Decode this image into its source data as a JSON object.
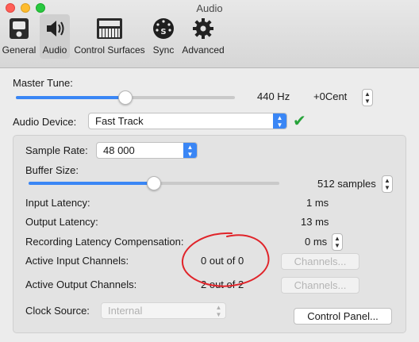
{
  "window": {
    "title": "Audio"
  },
  "toolbar": {
    "tabs": [
      {
        "label": "General",
        "icon": "speaker-box-icon"
      },
      {
        "label": "Audio",
        "icon": "speaker-icon"
      },
      {
        "label": "Control Surfaces",
        "icon": "keyboard-icon"
      },
      {
        "label": "Sync",
        "icon": "sync-icon"
      },
      {
        "label": "Advanced",
        "icon": "gear-icon"
      }
    ],
    "active": "Audio"
  },
  "master_tune": {
    "label": "Master Tune:",
    "hz": "440 Hz",
    "cent": "+0Cent",
    "level": 0.5
  },
  "audio_device": {
    "label": "Audio Device:",
    "value": "Fast Track",
    "status_color": "#27a33a"
  },
  "sample_rate": {
    "label": "Sample Rate:",
    "value": "48 000"
  },
  "buffer_size": {
    "label": "Buffer Size:",
    "value": "512 samples",
    "level": 0.5
  },
  "input_latency": {
    "label": "Input Latency:",
    "value": "1 ms"
  },
  "output_latency": {
    "label": "Output Latency:",
    "value": "13 ms"
  },
  "recording_latency": {
    "label": "Recording Latency Compensation:",
    "value": "0 ms"
  },
  "active_input": {
    "label": "Active Input Channels:",
    "value": "0 out of 0",
    "button": "Channels..."
  },
  "active_output": {
    "label": "Active Output Channels:",
    "value": "2 out of 2",
    "button": "Channels..."
  },
  "clock_source": {
    "label": "Clock Source:",
    "value": "Internal"
  },
  "control_panel": {
    "label": "Control Panel..."
  },
  "colors": {
    "accent": "#3a86f5",
    "annotation": "#e0242a"
  }
}
